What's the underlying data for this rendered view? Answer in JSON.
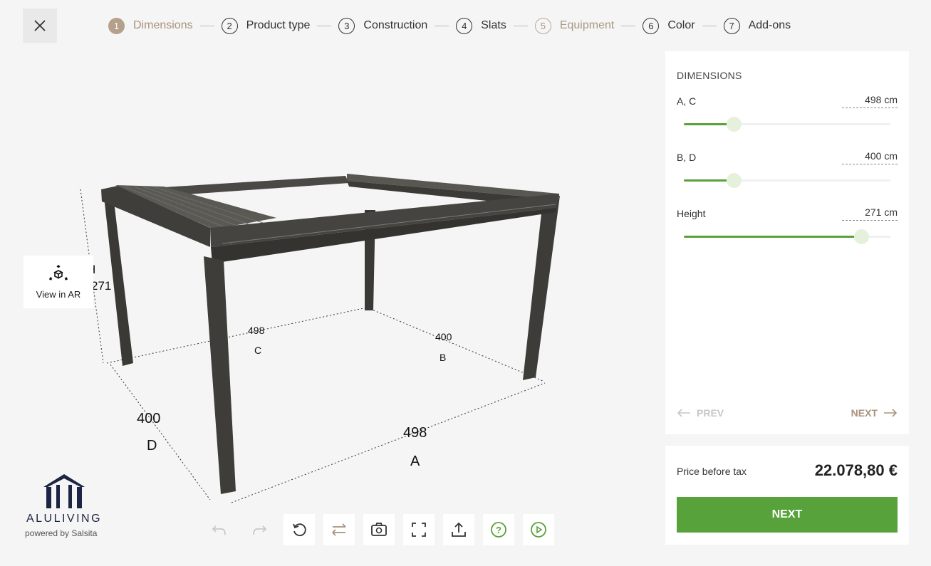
{
  "header": {
    "steps": [
      {
        "num": "1",
        "label": "Dimensions",
        "state": "active"
      },
      {
        "num": "2",
        "label": "Product type",
        "state": "default"
      },
      {
        "num": "3",
        "label": "Construction",
        "state": "default"
      },
      {
        "num": "4",
        "label": "Slats",
        "state": "default"
      },
      {
        "num": "5",
        "label": "Equipment",
        "state": "muted"
      },
      {
        "num": "6",
        "label": "Color",
        "state": "default"
      },
      {
        "num": "7",
        "label": "Add-ons",
        "state": "default"
      }
    ]
  },
  "viewer": {
    "ar_label": "View in AR",
    "dims": {
      "h_label": "H",
      "h_value": "271",
      "c_value": "498",
      "c_label": "C",
      "b_value": "400",
      "b_label": "B",
      "d_value": "400",
      "d_label": "D",
      "a_value": "498",
      "a_label": "A"
    }
  },
  "brand": {
    "name": "ALULIVING",
    "powered": "powered by Salsita"
  },
  "panel": {
    "title": "DIMENSIONS",
    "params": [
      {
        "label": "A, C",
        "value": "498 cm",
        "fraction": 0.24
      },
      {
        "label": "B, D",
        "value": "400 cm",
        "fraction": 0.24
      },
      {
        "label": "Height",
        "value": "271 cm",
        "fraction": 0.86
      }
    ],
    "prev_label": "PREV",
    "next_label": "NEXT"
  },
  "price": {
    "label": "Price before tax",
    "value": "22.078,80 €",
    "button": "NEXT"
  },
  "colors": {
    "accent": "#57a23b",
    "beige": "#b5a08b",
    "frame": "#3f3e3a"
  },
  "toolbar": {
    "icons": [
      "undo-icon",
      "redo-icon",
      "reset-view-icon",
      "swap-icon",
      "camera-icon",
      "fullscreen-icon",
      "share-icon",
      "help-icon",
      "play-icon"
    ]
  }
}
